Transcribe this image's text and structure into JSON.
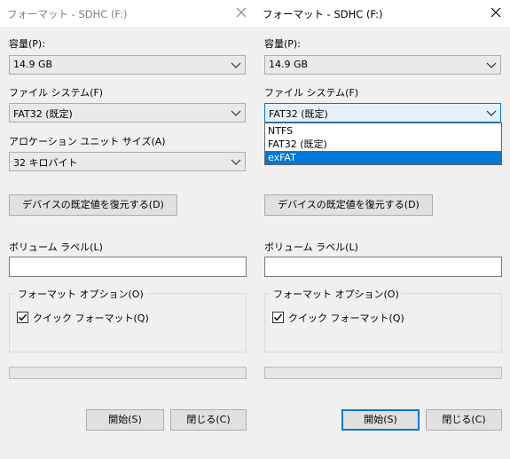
{
  "left_dialog": {
    "title": "フォーマット - SDHC (F:)",
    "capacity_label": "容量(P):",
    "capacity_value": "14.9 GB",
    "filesystem_label": "ファイル システム(F)",
    "filesystem_value": "FAT32 (既定)",
    "allocation_label": "アロケーション ユニット サイズ(A)",
    "allocation_value": "32 キロバイト",
    "restore_defaults_label": "デバイスの既定値を復元する(D)",
    "volume_label": "ボリューム ラベル(L)",
    "volume_value": "",
    "options_group_label": "フォーマット オプション(O)",
    "quick_format_label": "クイック フォーマット(Q)",
    "quick_format_checked": true,
    "progress_percent": 0,
    "start_label": "開始(S)",
    "close_label": "閉じる(C)"
  },
  "right_dialog": {
    "title": "フォーマット - SDHC (F:)",
    "capacity_label": "容量(P):",
    "capacity_value": "14.9 GB",
    "filesystem_label": "ファイル システム(F)",
    "filesystem_value": "FAT32 (既定)",
    "filesystem_options": [
      "NTFS",
      "FAT32 (既定)",
      "exFAT"
    ],
    "filesystem_highlighted_option": "exFAT",
    "restore_defaults_label": "デバイスの既定値を復元する(D)",
    "volume_label": "ボリューム ラベル(L)",
    "volume_value": "",
    "options_group_label": "フォーマット オプション(O)",
    "quick_format_label": "クイック フォーマット(Q)",
    "quick_format_checked": true,
    "progress_percent": 0,
    "start_label": "開始(S)",
    "close_label": "閉じる(C)"
  },
  "colors": {
    "window_bg": "#f0f0f0",
    "accent": "#0078d7",
    "button_bg": "#e1e1e1",
    "inactive_title": "#7f7f7f"
  },
  "icons": {
    "close": "close-icon",
    "dropdown": "chevron-down-icon",
    "checkbox": "checkmark-icon"
  }
}
